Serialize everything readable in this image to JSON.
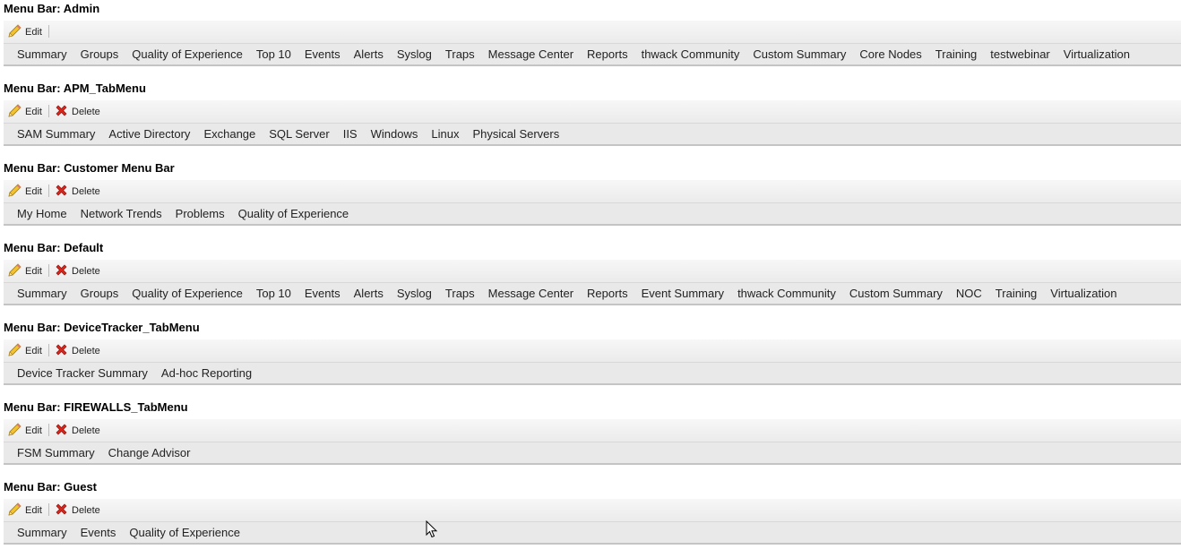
{
  "toolbar": {
    "edit_label": "Edit",
    "delete_label": "Delete"
  },
  "menubars": [
    {
      "title": "Menu Bar: Admin",
      "deletable": false,
      "tabs": [
        "Summary",
        "Groups",
        "Quality of Experience",
        "Top 10",
        "Events",
        "Alerts",
        "Syslog",
        "Traps",
        "Message Center",
        "Reports",
        "thwack Community",
        "Custom Summary",
        "Core Nodes",
        "Training",
        "testwebinar",
        "Virtualization"
      ]
    },
    {
      "title": "Menu Bar: APM_TabMenu",
      "deletable": true,
      "tabs": [
        "SAM Summary",
        "Active Directory",
        "Exchange",
        "SQL Server",
        "IIS",
        "Windows",
        "Linux",
        "Physical Servers"
      ]
    },
    {
      "title": "Menu Bar: Customer Menu Bar",
      "deletable": true,
      "tabs": [
        "My Home",
        "Network Trends",
        "Problems",
        "Quality of Experience"
      ]
    },
    {
      "title": "Menu Bar: Default",
      "deletable": true,
      "tabs": [
        "Summary",
        "Groups",
        "Quality of Experience",
        "Top 10",
        "Events",
        "Alerts",
        "Syslog",
        "Traps",
        "Message Center",
        "Reports",
        "Event Summary",
        "thwack Community",
        "Custom Summary",
        "NOC",
        "Training",
        "Virtualization"
      ]
    },
    {
      "title": "Menu Bar: DeviceTracker_TabMenu",
      "deletable": true,
      "tabs": [
        "Device Tracker Summary",
        "Ad-hoc Reporting"
      ]
    },
    {
      "title": "Menu Bar: FIREWALLS_TabMenu",
      "deletable": true,
      "tabs": [
        "FSM Summary",
        "Change Advisor"
      ]
    },
    {
      "title": "Menu Bar: Guest",
      "deletable": true,
      "tabs": [
        "Summary",
        "Events",
        "Quality of Experience"
      ]
    }
  ],
  "icons": {
    "edit": "pencil-icon",
    "delete": "red-x-icon"
  },
  "colors": {
    "toolbar_bg": "#eeeeee",
    "tabs_bg": "#e9e9e9",
    "delete_red": "#d9261c",
    "pencil_yellow": "#f2c230"
  }
}
